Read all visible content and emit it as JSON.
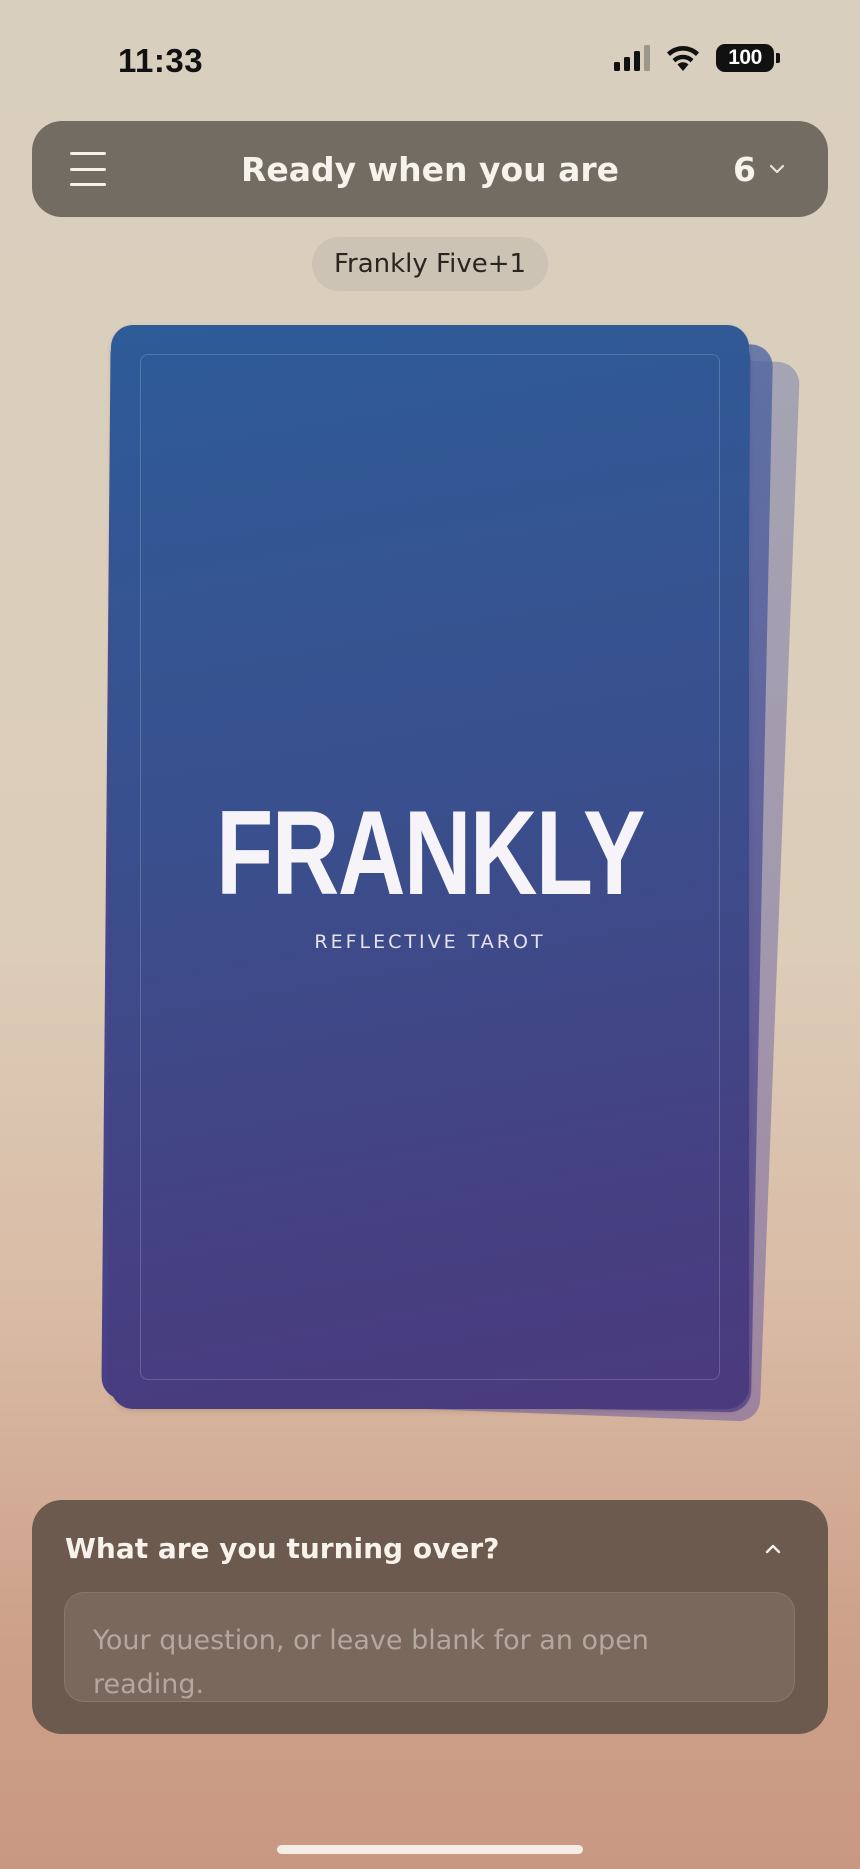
{
  "status_bar": {
    "time": "11:33",
    "battery": "100",
    "icons": [
      "signal-icon",
      "wifi-icon",
      "battery-icon"
    ]
  },
  "header": {
    "title": "Ready when you are",
    "card_count": "6",
    "menu_icon": "hamburger-menu-icon",
    "dropdown_icon": "chevron-down-icon"
  },
  "spread": {
    "name": "Frankly Five+1"
  },
  "card": {
    "logo": "FRANKLY",
    "tagline": "REFLECTIVE TAROT"
  },
  "question": {
    "label": "What are you turning over?",
    "value": "",
    "placeholder": "Your question, or leave blank for an open reading.",
    "toggle_icon": "chevron-up-icon"
  },
  "colors": {
    "header_bg": "#736c63",
    "card_top": "#2d5c98",
    "card_bottom": "#4a3a7e",
    "panel_bg": "#6c5a4f",
    "chip_bg": "#cdc3b4"
  }
}
